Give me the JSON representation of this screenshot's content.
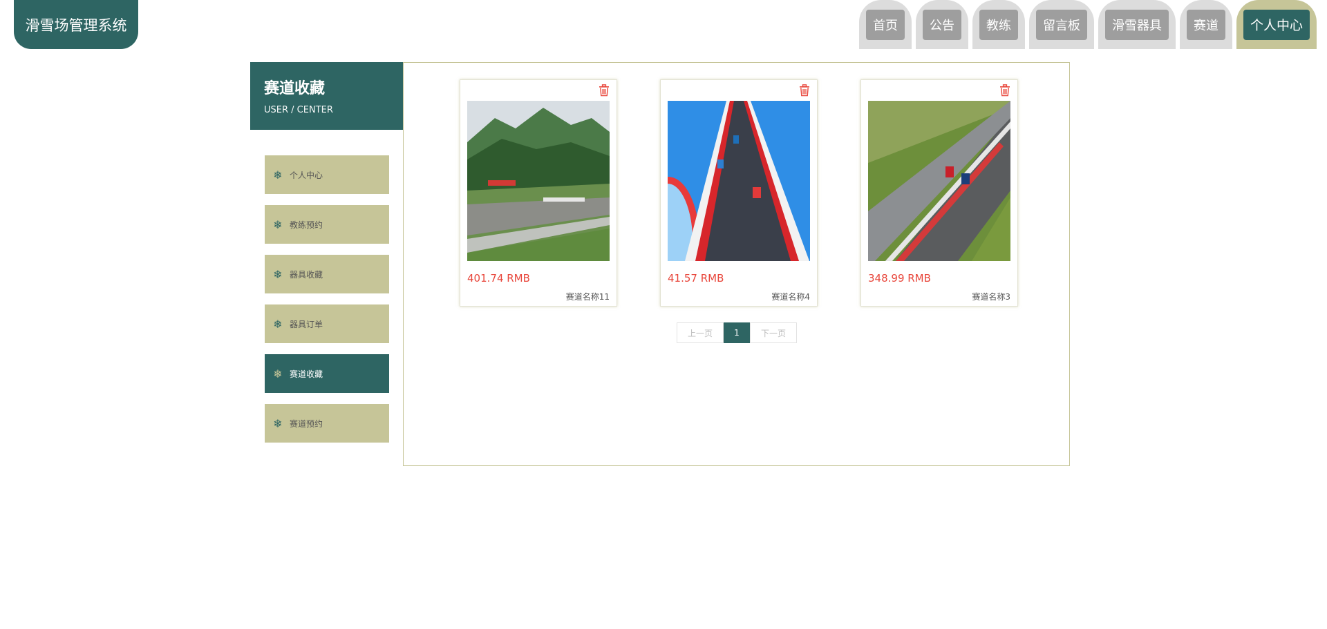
{
  "app": {
    "title": "滑雪场管理系统"
  },
  "nav": {
    "items": [
      {
        "label": "首页",
        "active": false
      },
      {
        "label": "公告",
        "active": false
      },
      {
        "label": "教练",
        "active": false
      },
      {
        "label": "留言板",
        "active": false
      },
      {
        "label": "滑雪器具",
        "active": false
      },
      {
        "label": "赛道",
        "active": false
      },
      {
        "label": "个人中心",
        "active": true
      }
    ]
  },
  "sidebar": {
    "title": "赛道收藏",
    "subtitle": "USER / CENTER",
    "items": [
      {
        "label": "个人中心",
        "icon": "snowflake-icon",
        "active": false
      },
      {
        "label": "教练预约",
        "icon": "snowflake-icon",
        "active": false
      },
      {
        "label": "器具收藏",
        "icon": "snowflake-icon",
        "active": false
      },
      {
        "label": "器具订单",
        "icon": "snowflake-icon",
        "active": false
      },
      {
        "label": "赛道收藏",
        "icon": "snowflake-icon",
        "active": true
      },
      {
        "label": "赛道预约",
        "icon": "snowflake-icon",
        "active": false
      }
    ]
  },
  "favorites": [
    {
      "price": "401.74 RMB",
      "name": "赛道名称11",
      "image": "mountain-race-track-photo"
    },
    {
      "price": "41.57 RMB",
      "name": "赛道名称4",
      "image": "cartoon-ramp-track-with-cars"
    },
    {
      "price": "348.99 RMB",
      "name": "赛道名称3",
      "image": "motion-blur-race-track-with-cars"
    }
  ],
  "pagination": {
    "prev": "上一页",
    "current": "1",
    "next": "下一页"
  },
  "colors": {
    "primary": "#2e6563",
    "accent": "#c6c598",
    "price": "#e8453a",
    "nav_inactive": "#9e9e9e"
  }
}
